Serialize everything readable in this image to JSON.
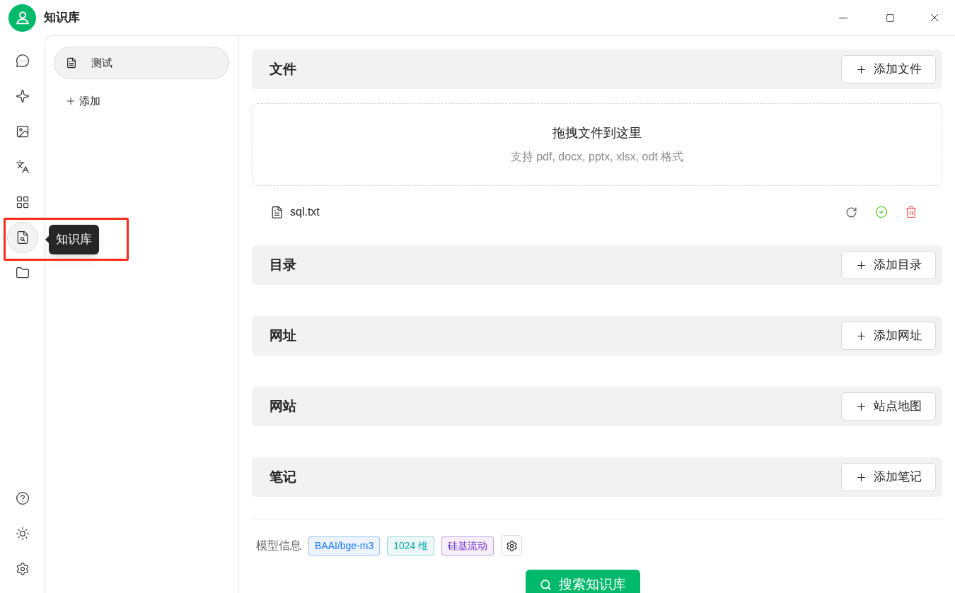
{
  "window": {
    "title": "知识库"
  },
  "rail": {
    "items": [
      {
        "selected": false
      },
      {
        "selected": false
      },
      {
        "selected": false
      },
      {
        "selected": false
      },
      {
        "selected": false
      },
      {
        "selected": true
      },
      {
        "selected": false
      }
    ],
    "tooltip": "知识库"
  },
  "knowledge_list": {
    "items": [
      {
        "label": "测试",
        "selected": true
      }
    ],
    "add_label": "添加"
  },
  "sections": [
    {
      "kind": "files",
      "title": "文件",
      "button": "添加文件",
      "dropzone": {
        "title": "拖拽文件到这里",
        "hint": "支持 pdf, docx, pptx, xlsx, odt 格式"
      },
      "files": [
        {
          "name": "sql.txt",
          "done": true
        }
      ]
    },
    {
      "kind": "plain",
      "title": "目录",
      "button": "添加目录"
    },
    {
      "kind": "plain",
      "title": "网址",
      "button": "添加网址"
    },
    {
      "kind": "plain",
      "title": "网站",
      "button": "站点地图"
    },
    {
      "kind": "plain",
      "title": "笔记",
      "button": "添加笔记"
    }
  ],
  "model_info": {
    "label": "模型信息",
    "tags": [
      {
        "text": "BAAI/bge-m3",
        "color": "#1677ff"
      },
      {
        "text": "1024 维",
        "color": "#13a8a8"
      },
      {
        "text": "硅基流动",
        "color": "#722ed1"
      }
    ]
  },
  "search_button": "搜索知识库"
}
